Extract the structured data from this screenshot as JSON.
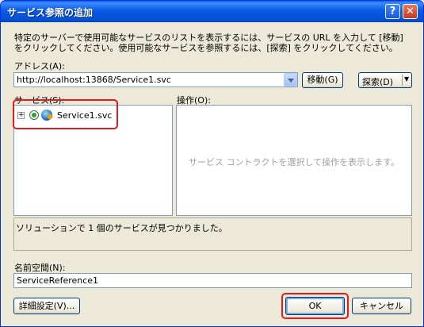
{
  "window": {
    "title": "サービス参照の追加"
  },
  "description": "特定のサーバーで使用可能なサービスのリストを表示するには、サービスの URL を入力して [移動] をクリックしてください。使用可能なサービスを参照するには、[探索] をクリックしてください。",
  "address": {
    "label": "アドレス(A):",
    "value": "http://localhost:13868/Service1.svc",
    "go_button": "移動(G)",
    "discover_button": "探索(D)"
  },
  "services": {
    "label": "サービス(S):",
    "items": [
      {
        "label": "Service1.svc"
      }
    ]
  },
  "operations": {
    "label": "操作(O):",
    "placeholder": "サービス コントラクトを選択して操作を表示します。"
  },
  "status": {
    "text": "ソリューションで 1 個のサービスが見つかりました。"
  },
  "namespace": {
    "label": "名前空間(N):",
    "value": "ServiceReference1"
  },
  "buttons": {
    "advanced": "詳細設定(V)...",
    "ok": "OK",
    "cancel": "キャンセル"
  }
}
